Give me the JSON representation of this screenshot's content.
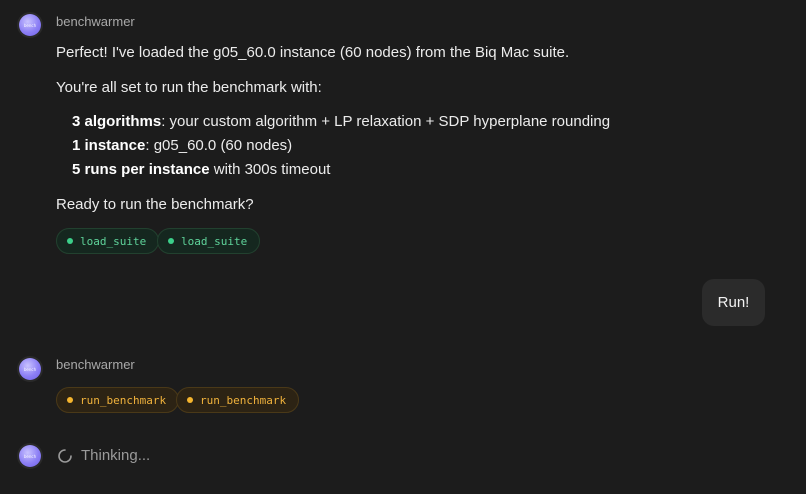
{
  "assistant_name": "benchwarmer",
  "avatar_text": "bench",
  "message1": {
    "line1": "Perfect! I've loaded the g05_60.0 instance (60 nodes) from the Biq Mac suite.",
    "line2": "You're all set to run the benchmark with:",
    "bullets": [
      {
        "bold": "3 algorithms",
        "rest": ": your custom algorithm + LP relaxation + SDP hyperplane rounding"
      },
      {
        "bold": "1 instance",
        "rest": ": g05_60.0 (60 nodes)"
      },
      {
        "bold": "5 runs per instance",
        "rest": " with 300s timeout"
      }
    ],
    "line3": "Ready to run the benchmark?",
    "tools": [
      "load_suite",
      "load_suite"
    ]
  },
  "user_message": "Run!",
  "message2": {
    "tools": [
      "run_benchmark",
      "run_benchmark"
    ]
  },
  "thinking_label": "Thinking...",
  "colors": {
    "background": "#1c1c1c",
    "tool_success": "#3ccf8a",
    "tool_running": "#f5b52e",
    "avatar": "#8c7ff5"
  }
}
